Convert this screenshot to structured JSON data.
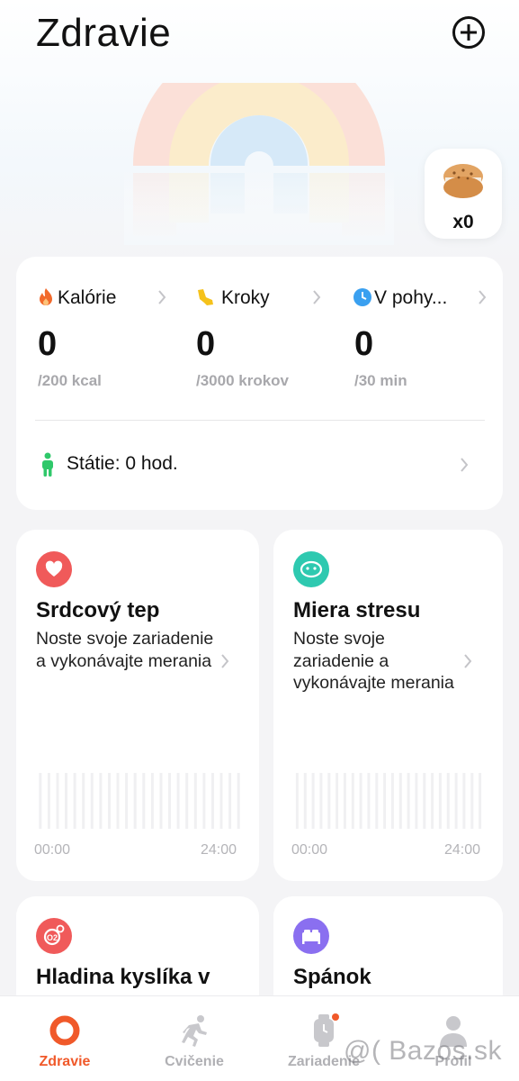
{
  "header": {
    "title": "Zdravie"
  },
  "rewards": {
    "count": "x0"
  },
  "activity": {
    "metrics": [
      {
        "label": "Kalórie",
        "value": "0",
        "goal": "/200 kcal",
        "icon": "flame-icon",
        "color": "#f26a2c"
      },
      {
        "label": "Kroky",
        "value": "0",
        "goal": "/3000 krokov",
        "icon": "shoe-icon",
        "color": "#f5c21b"
      },
      {
        "label": "V pohy...",
        "value": "0",
        "goal": "/30 min",
        "icon": "clock-icon",
        "color": "#3aa0f0"
      }
    ],
    "standing": {
      "label": "Státie: 0 hod.",
      "icon": "person-icon",
      "color": "#2fc86a"
    }
  },
  "health_cards": [
    {
      "title": "Srdcový tep",
      "description": "Noste svoje zariadenie a vykonávajte merania",
      "icon": "heart-icon",
      "color": "#f05a5a",
      "time_start": "00:00",
      "time_end": "24:00"
    },
    {
      "title": "Miera stresu",
      "description": "Noste svoje zariadenie a vykonávajte merania",
      "icon": "face-icon",
      "color": "#2ec9b0",
      "time_start": "00:00",
      "time_end": "24:00"
    },
    {
      "title": "Hladina kyslíka v",
      "icon": "oxygen-icon",
      "color": "#f05a5a"
    },
    {
      "title": "Spánok",
      "icon": "bed-icon",
      "color": "#8a6ff0"
    }
  ],
  "nav": {
    "active": "Zdravie",
    "items": [
      "Zdravie",
      "Cvičenie",
      "Zariadenie",
      "Profil"
    ]
  },
  "watermark": "@( Bazos.sk"
}
